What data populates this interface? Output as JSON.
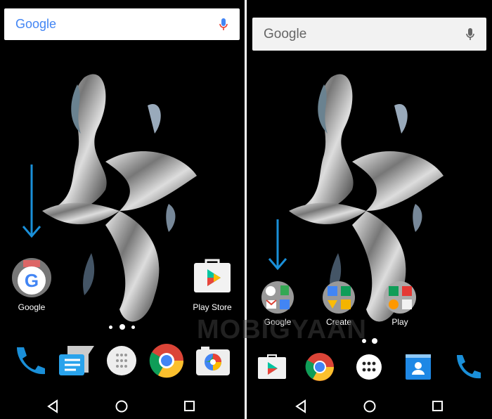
{
  "left_screen": {
    "search": {
      "logo": "Google",
      "mic_icon": "mic-icon"
    },
    "home_icons": [
      {
        "label": "Google",
        "icon": "google-app-icon"
      },
      {
        "label": "Play Store",
        "icon": "play-store-icon"
      }
    ],
    "page_dots": 3,
    "active_page": 2,
    "dock": [
      "phone-icon",
      "messenger-icon",
      "app-drawer-icon",
      "chrome-icon",
      "camera-icon"
    ],
    "arrow_color": "#1a8fd8"
  },
  "right_screen": {
    "search": {
      "logo": "Google",
      "mic_icon": "mic-icon"
    },
    "folders": [
      {
        "label": "Google"
      },
      {
        "label": "Create"
      },
      {
        "label": "Play"
      }
    ],
    "page_dots": 2,
    "dock": [
      "play-store-icon",
      "chrome-icon",
      "app-drawer-icon",
      "contacts-icon",
      "phone-icon"
    ]
  },
  "watermark": "MOBIGYAAN",
  "nav": [
    "back",
    "home",
    "recents"
  ]
}
